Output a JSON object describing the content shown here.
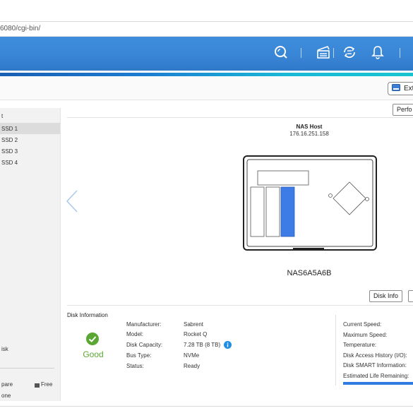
{
  "browser": {
    "address": "6080/cgi-bin/"
  },
  "header": {
    "icons": [
      "search-icon",
      "task-icon",
      "sync-icon",
      "notification-icon"
    ],
    "colors": {
      "header": "#3a86d6",
      "accent_start": "#1a5fb4",
      "accent_end": "#19c4cf"
    }
  },
  "toolbar": {
    "ext_label": "Ext"
  },
  "sidebar": {
    "heading": "t",
    "items": [
      "SSD 1",
      "SSD 2",
      "SSD 3",
      "SSD 4"
    ],
    "selected_index": 0,
    "bottom_item": "isk",
    "legend_spare": "pare",
    "legend_free": "Free",
    "last_line": "one"
  },
  "main": {
    "perf_label": "Perfo",
    "nas_host_label": "NAS Host",
    "nas_host_ip": "176.16.251.158",
    "nas_name": "NAS6A5A6B",
    "disk_info_button": "Disk Info",
    "selected_slot_color": "#3d7be6"
  },
  "disk_info": {
    "title": "Disk Information",
    "health": "Good",
    "health_color": "#5aa733",
    "fields": [
      {
        "label": "Manufacturer:",
        "value": "Sabrent"
      },
      {
        "label": "Model:",
        "value": "Rocket Q"
      },
      {
        "label": "Disk Capacity:",
        "value": "7.28 TB (8 TB)"
      },
      {
        "label": "Bus Type:",
        "value": "NVMe"
      },
      {
        "label": "Status:",
        "value": "Ready"
      }
    ],
    "right_labels": [
      "Current Speed:",
      "Maximum Speed:",
      "Temperature:",
      "Disk Access History (I/O):",
      "Disk SMART Information:",
      "Estimated Life Remaining:"
    ]
  }
}
